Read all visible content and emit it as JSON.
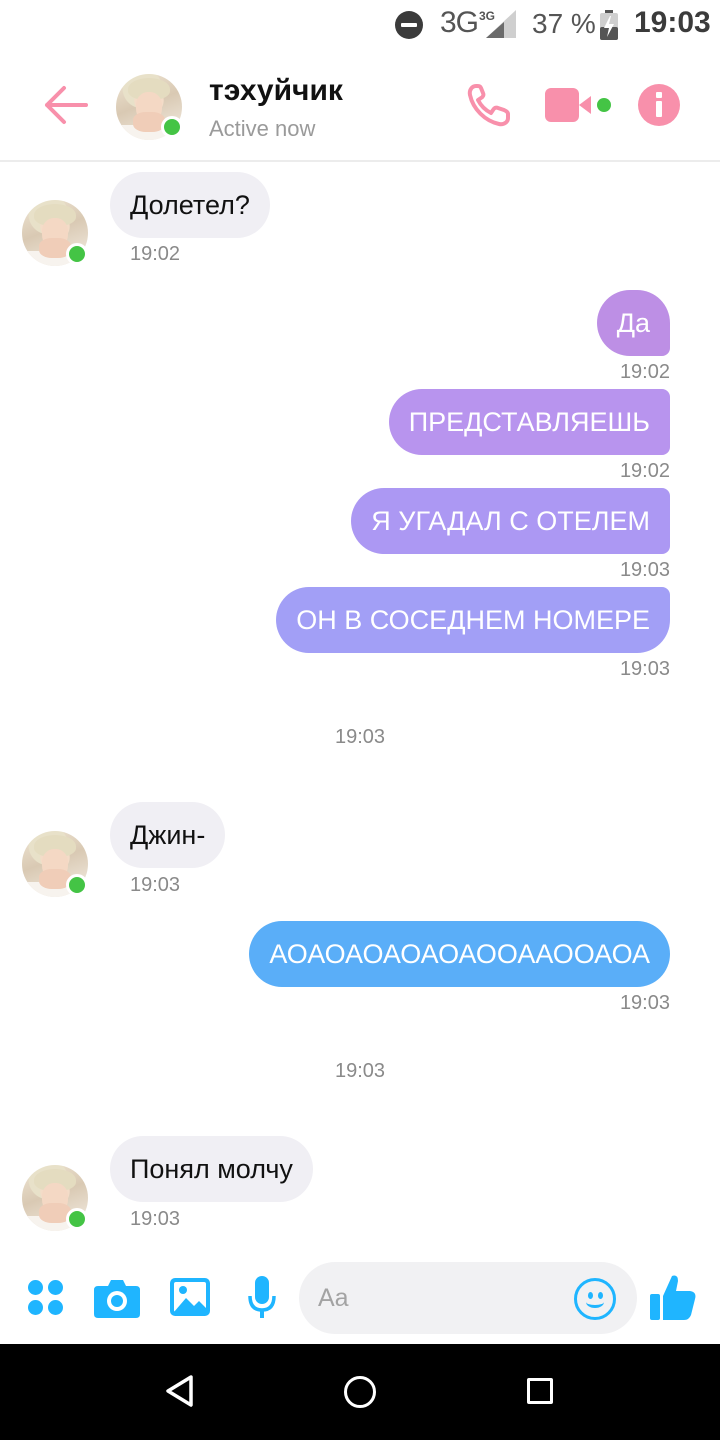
{
  "status_bar": {
    "network": "3G",
    "network_small": "3G",
    "battery": "37 %",
    "time": "19:03"
  },
  "header": {
    "name": "тэхуйчик",
    "status": "Active now"
  },
  "colors": {
    "accent_pink": "#f890ab",
    "accent_blue": "#1fb5ff",
    "online": "#44c445",
    "bubble_in": "#f0eff4",
    "bubble_out_1": "#bd8fe5",
    "bubble_out_2": "#b894ee",
    "bubble_out_3": "#ac98f3",
    "bubble_out_4": "#a29ff6",
    "bubble_out_blue": "#5aaef8"
  },
  "messages": [
    {
      "dir": "in",
      "text": "Долетел?",
      "time": "19:02"
    },
    {
      "dir": "out",
      "text": "Да",
      "time": "19:02"
    },
    {
      "dir": "out",
      "text": "ПРЕДСТАВЛЯЕШЬ",
      "time": "19:02"
    },
    {
      "dir": "out",
      "text": "Я УГАДАЛ С ОТЕЛЕМ",
      "time": "19:03"
    },
    {
      "dir": "out",
      "text": "ОН В СОСЕДНЕМ НОМЕРЕ",
      "time": "19:03"
    },
    {
      "dir": "sep",
      "time": "19:03"
    },
    {
      "dir": "in",
      "text": "Джин-",
      "time": "19:03"
    },
    {
      "dir": "out",
      "text": "АОАОАОАОАОАООААООАОА",
      "time": "19:03"
    },
    {
      "dir": "sep",
      "time": "19:03"
    },
    {
      "dir": "in",
      "text": "Понял молчу",
      "time": "19:03"
    }
  ],
  "composer": {
    "placeholder": "Aa",
    "icons": [
      "more-icon",
      "camera-icon",
      "gallery-icon",
      "mic-icon",
      "emoji-icon",
      "like-icon"
    ]
  },
  "nav_bar": {
    "icons": [
      "back-triangle-icon",
      "home-circle-icon",
      "recent-square-icon"
    ]
  }
}
